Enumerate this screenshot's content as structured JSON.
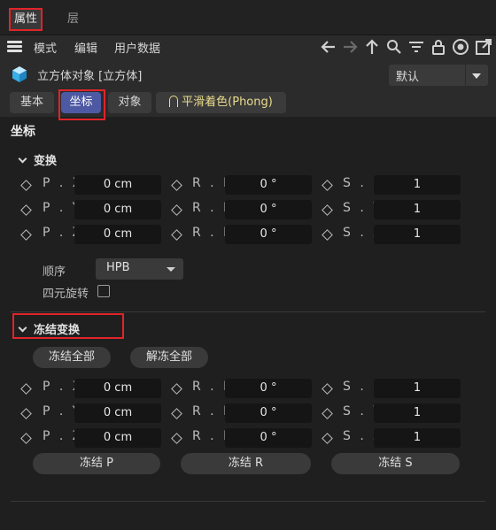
{
  "tabs": {
    "properties": "属性",
    "layers": "层"
  },
  "menu": {
    "mode": "模式",
    "edit": "编辑",
    "user_data": "用户数据"
  },
  "toolbar_icons": [
    "arrow-left-icon",
    "arrow-right-icon",
    "arrow-up-icon",
    "search-icon",
    "filter-icon",
    "lock-icon",
    "target-icon",
    "new-window-icon"
  ],
  "object": {
    "title": "立方体对象 [立方体]",
    "preset": "默认"
  },
  "subtabs": {
    "basic": "基本",
    "coord": "坐标",
    "object": "对象",
    "phong": "平滑着色(Phong)"
  },
  "section_title": "坐标",
  "transform": {
    "title": "变换",
    "rows": [
      {
        "p_label": "P . X",
        "p_value": "0 cm",
        "r_label": "R . H",
        "r_value": "0 °",
        "s_label": "S . X",
        "s_value": "1"
      },
      {
        "p_label": "P . Y",
        "p_value": "0 cm",
        "r_label": "R . P",
        "r_value": "0 °",
        "s_label": "S . Y",
        "s_value": "1"
      },
      {
        "p_label": "P . Z",
        "p_value": "0 cm",
        "r_label": "R . B",
        "r_value": "0 °",
        "s_label": "S . Z",
        "s_value": "1"
      }
    ],
    "order_label": "顺序",
    "order_value": "HPB",
    "quaternion_label": "四元旋转"
  },
  "freeze": {
    "title": "冻结变换",
    "freeze_all": "冻结全部",
    "unfreeze_all": "解冻全部",
    "rows": [
      {
        "p_label": "P . X",
        "p_value": "0 cm",
        "r_label": "R . H",
        "r_value": "0 °",
        "s_label": "S . X",
        "s_value": "1"
      },
      {
        "p_label": "P . Y",
        "p_value": "0 cm",
        "r_label": "R . P",
        "r_value": "0 °",
        "s_label": "S . Y",
        "s_value": "1"
      },
      {
        "p_label": "P . Z",
        "p_value": "0 cm",
        "r_label": "R . B",
        "r_value": "0 °",
        "s_label": "S . Z",
        "s_value": "1"
      }
    ],
    "freeze_p": "冻结 P",
    "freeze_r": "冻结 R",
    "freeze_s": "冻结 S"
  },
  "colors": {
    "accent": "#4d5aa3",
    "highlight": "#e0242a",
    "phong_text": "#e9dc8c"
  }
}
